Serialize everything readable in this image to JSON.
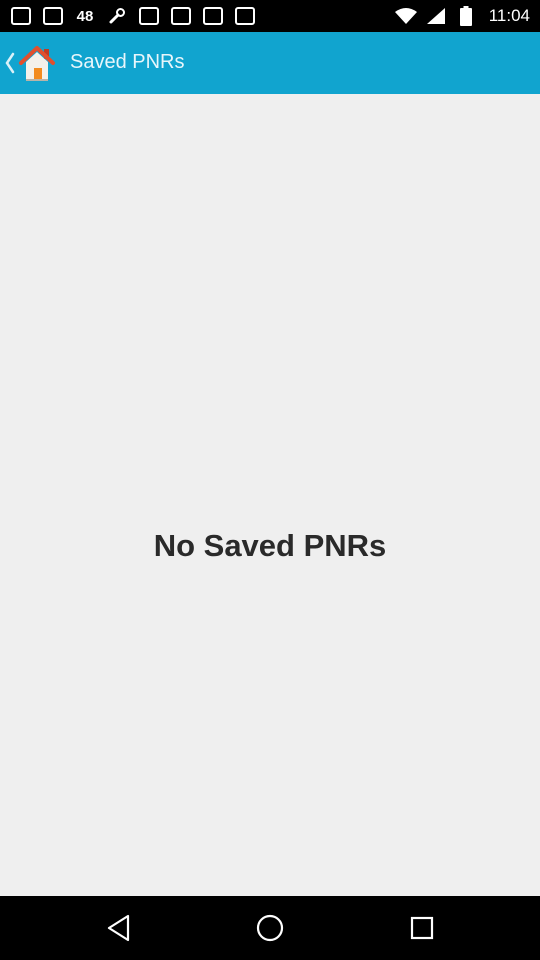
{
  "status_bar": {
    "time": "11:04",
    "badge_text": "48",
    "notification_icons": [
      "notification-icon",
      "notification-icon",
      "48-badge-icon",
      "wrench-icon",
      "notification-icon",
      "notification-icon",
      "notification-icon",
      "notification-icon"
    ],
    "system_icons": [
      "wifi-icon",
      "signal-icon",
      "battery-icon"
    ]
  },
  "app_bar": {
    "title": "Saved PNRs",
    "back_icon": "chevron-left-icon",
    "home_icon": "home-icon",
    "color": "#11a4cf"
  },
  "main": {
    "empty_message": "No Saved PNRs"
  },
  "nav_bar": {
    "buttons": [
      "back-icon",
      "home-circle-icon",
      "recents-icon"
    ]
  }
}
